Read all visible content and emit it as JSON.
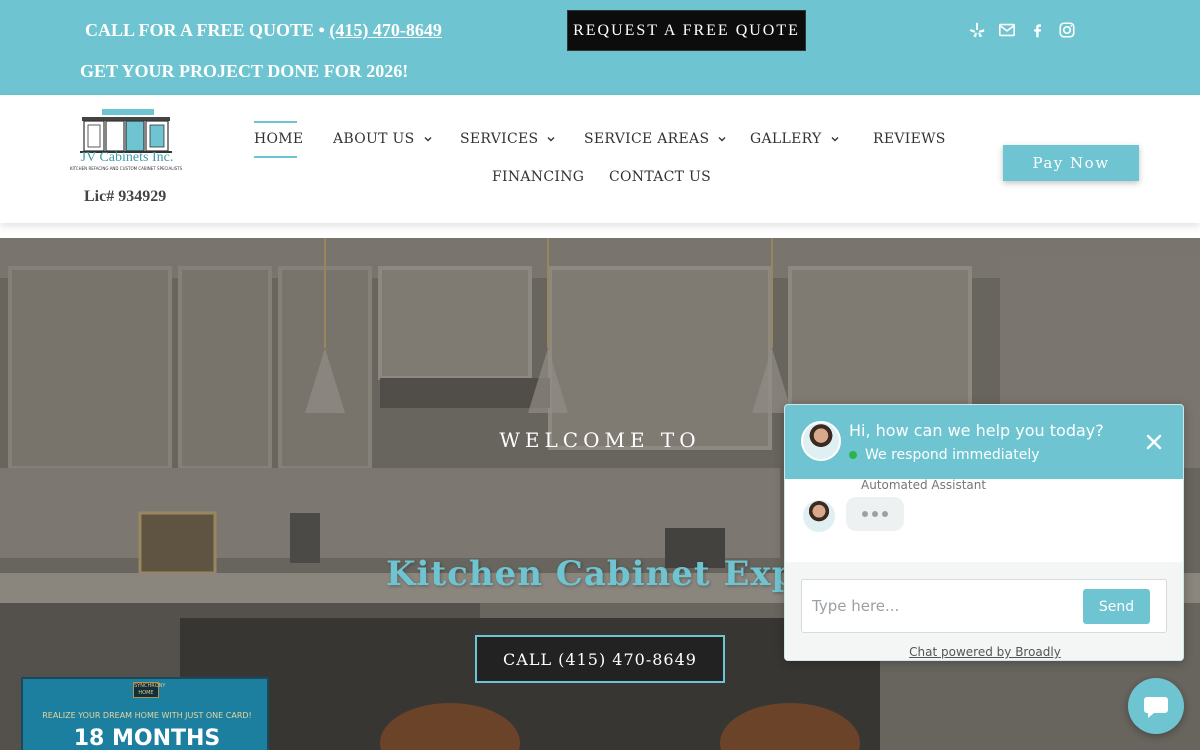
{
  "topbar": {
    "cta_prefix": "CALL FOR A FREE QUOTE • ",
    "phone": "(415) 470-8649",
    "tagline": "GET YOUR PROJECT DONE FOR 2026!",
    "quote_button": "REQUEST A FREE QUOTE",
    "social_icons": [
      "yelp-icon",
      "mail-icon",
      "facebook-icon",
      "instagram-icon"
    ]
  },
  "header": {
    "logo_text": "JV Cabinets Inc.",
    "logo_subtext": "KITCHEN REFACING AND CUSTOM CABINET SPECIALISTS",
    "license": "Lic# 934929",
    "nav": {
      "home": "HOME",
      "about": "ABOUT US",
      "services": "SERVICES",
      "service_areas": "SERVICE AREAS",
      "gallery": "GALLERY",
      "reviews": "REVIEWS",
      "financing": "FINANCING",
      "contact": "CONTACT US"
    },
    "pay_button": "Pay Now"
  },
  "hero": {
    "welcome": "WELCOME TO",
    "title": "Kitchen Cabinet Exper",
    "call_button": "CALL (415) 470-8649",
    "promo": {
      "logo_text": "SYNCHRONY HOME",
      "line1": "REALIZE YOUR DREAM HOME WITH JUST ONE CARD!",
      "line2": "18 MONTHS"
    }
  },
  "chat": {
    "title": "Hi, how can we help you today?",
    "status": "We respond immediately",
    "assistant_label": "Automated Assistant",
    "input_placeholder": "Type here...",
    "send_label": "Send",
    "powered_by": "Chat powered by Broadly"
  },
  "colors": {
    "accent": "#6ec5d1",
    "dark": "#0c0c0c",
    "online": "#2db34a"
  }
}
